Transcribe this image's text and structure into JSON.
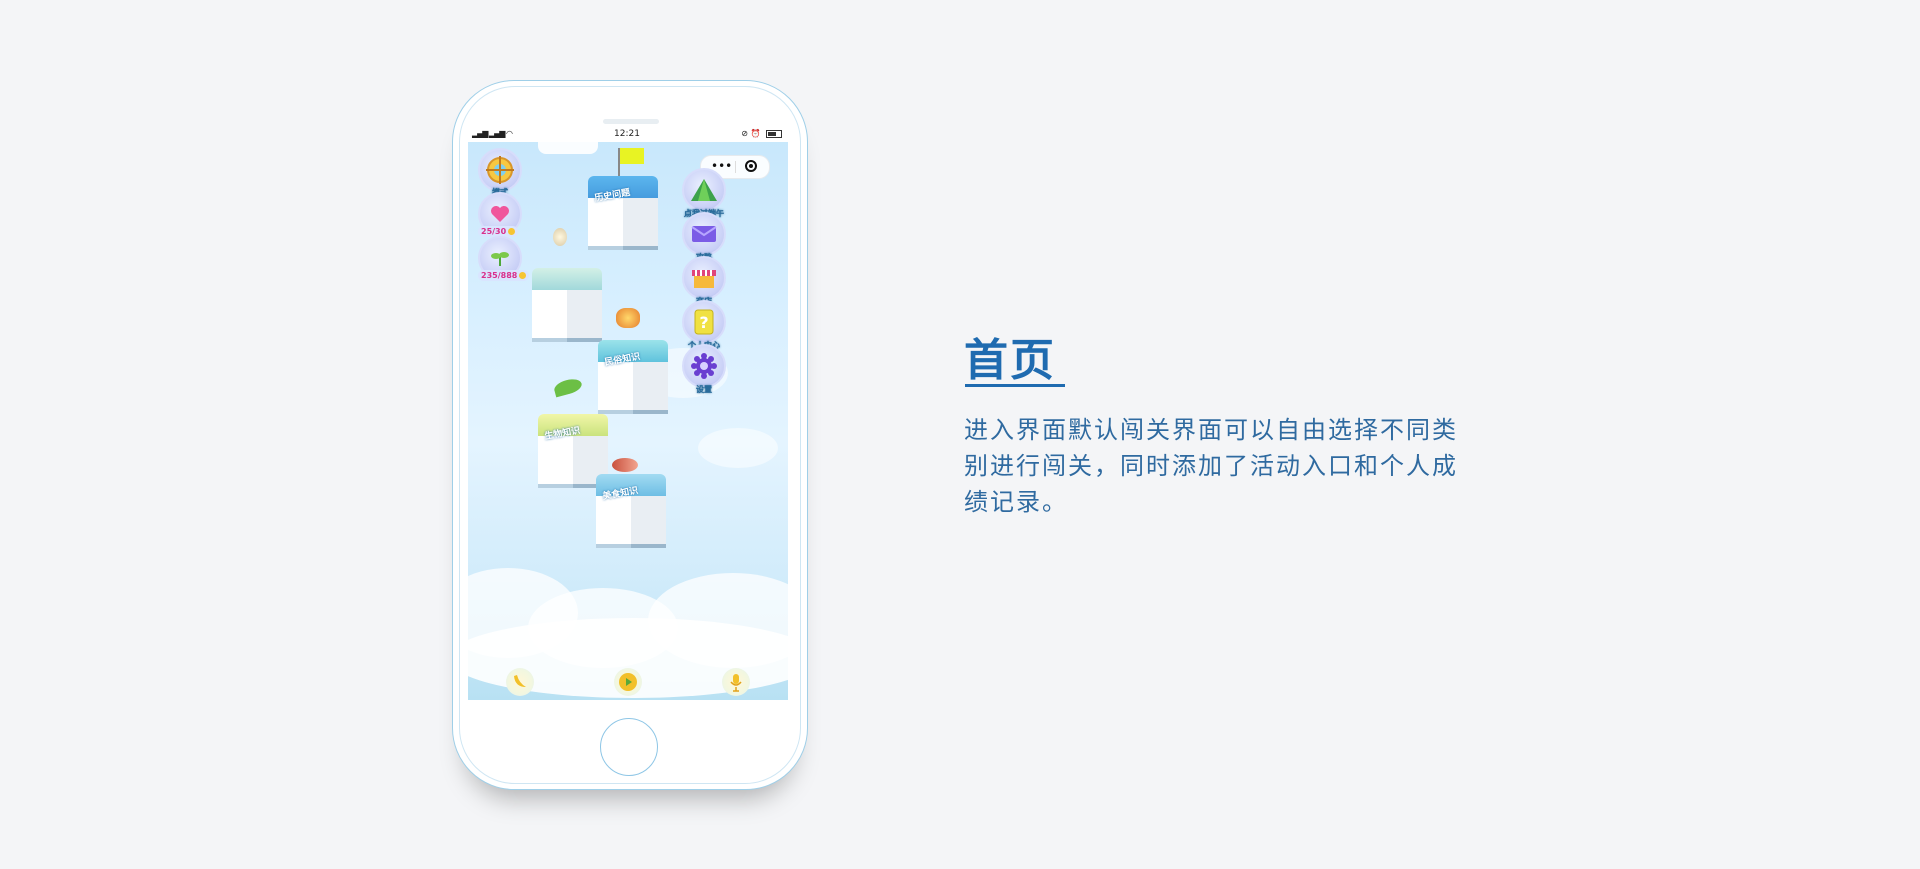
{
  "status_bar": {
    "time": "12:21"
  },
  "side_left": [
    {
      "label": "模式",
      "icon": "target-icon"
    },
    {
      "label": "",
      "icon": "heart-icon",
      "stat": "25/30"
    },
    {
      "label": "",
      "icon": "sprout-icon",
      "stat": "235/888"
    }
  ],
  "side_right": [
    {
      "label": "点我过端午",
      "icon": "zongzi-icon"
    },
    {
      "label": "攻略",
      "icon": "envelope-icon"
    },
    {
      "label": "商店",
      "icon": "shop-icon"
    },
    {
      "label": "个人中心",
      "icon": "question-icon"
    },
    {
      "label": "设置",
      "icon": "gear-icon"
    }
  ],
  "levels": [
    {
      "label": "历史问题",
      "color": "#4aa8e6"
    },
    {
      "label": "",
      "color": "#a7e0d8"
    },
    {
      "label": "民俗知识",
      "color": "#6cc7df"
    },
    {
      "label": "生物知识",
      "color": "#d8e88a"
    },
    {
      "label": "美食知识",
      "color": "#7bc7e8"
    }
  ],
  "bottom_bar": [
    {
      "icon": "banana-icon"
    },
    {
      "icon": "play-icon"
    },
    {
      "icon": "microphone-icon"
    }
  ],
  "panel": {
    "title": "首页",
    "description": "进入界面默认闯关界面可以自由选择不同类别进行闯关，同时添加了活动入口和个人成绩记录。"
  },
  "colors": {
    "accent": "#1f6bb0",
    "text": "#2f6aa0",
    "background": "#f4f5f7"
  }
}
